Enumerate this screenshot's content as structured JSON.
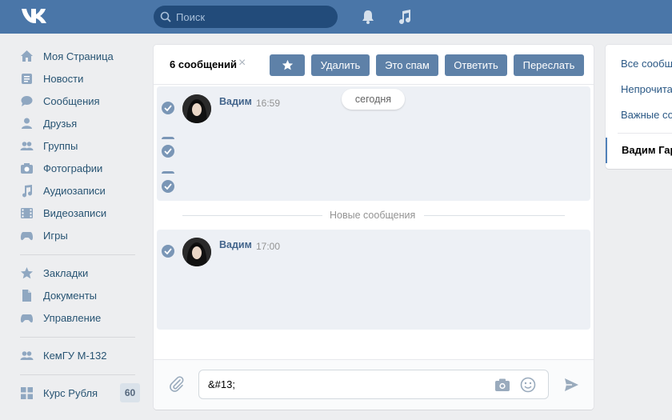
{
  "header": {
    "logo": "vk-logo",
    "search_placeholder": "Поиск"
  },
  "nav": {
    "items": [
      {
        "label": "Моя Страница",
        "icon": "home-icon"
      },
      {
        "label": "Новости",
        "icon": "news-icon"
      },
      {
        "label": "Сообщения",
        "icon": "messages-icon"
      },
      {
        "label": "Друзья",
        "icon": "friends-icon"
      },
      {
        "label": "Группы",
        "icon": "groups-icon"
      },
      {
        "label": "Фотографии",
        "icon": "camera-icon"
      },
      {
        "label": "Аудиозаписи",
        "icon": "music-icon"
      },
      {
        "label": "Видеозаписи",
        "icon": "video-icon"
      },
      {
        "label": "Игры",
        "icon": "gamepad-icon"
      }
    ],
    "items2": [
      {
        "label": "Закладки",
        "icon": "star-icon"
      },
      {
        "label": "Документы",
        "icon": "document-icon"
      },
      {
        "label": "Управление",
        "icon": "gamepad-icon"
      }
    ],
    "group": {
      "label": "КемГУ М-132",
      "icon": "group-icon"
    },
    "app": {
      "label": "Курс Рубля",
      "icon": "apps-icon",
      "badge": "60"
    }
  },
  "toolbar": {
    "selected": "6 сообщений",
    "clear": "×",
    "delete": "Удалить",
    "spam": "Это спам",
    "reply": "Ответить",
    "forward": "Переслать"
  },
  "messages": {
    "block1": {
      "author": "Вадим",
      "time": "16:59"
    },
    "day": "сегодня",
    "divider": "Новые сообщения",
    "block2": {
      "author": "Вадим",
      "time": "17:00"
    }
  },
  "composer": {
    "value": "&#13;"
  },
  "right_panel": {
    "all": "Все сообщ",
    "unread": "Непрочита",
    "important": "Важные со",
    "active": "Вадим Гар"
  },
  "colors": {
    "header": "#4a76a8",
    "button": "#5e81a8",
    "link": "#285473",
    "message_bg": "#edf0f5"
  }
}
